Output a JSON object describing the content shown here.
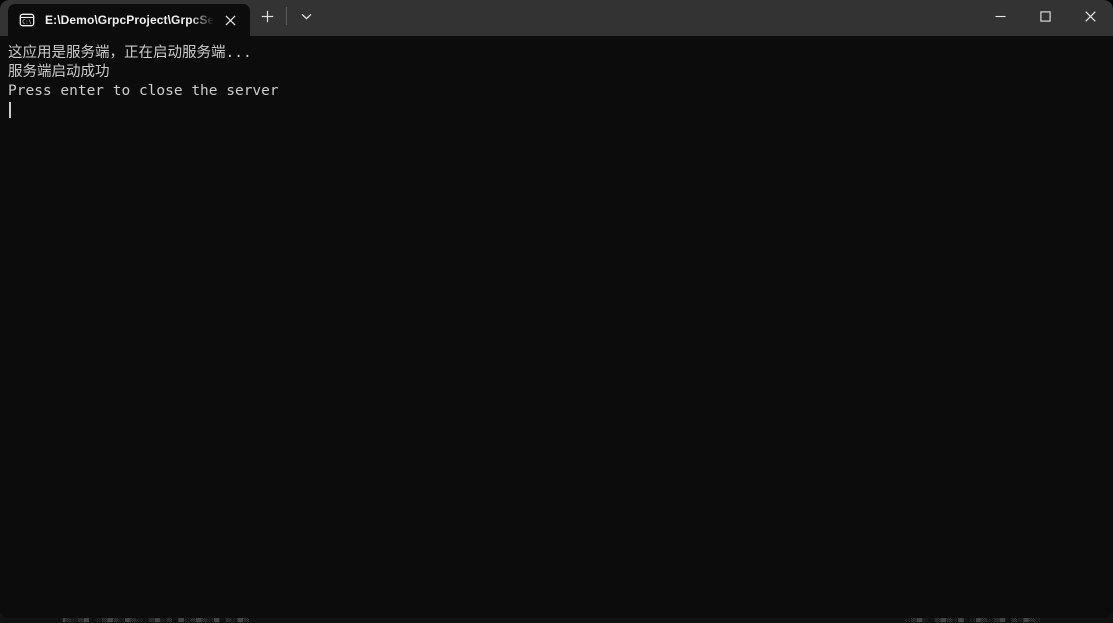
{
  "window": {
    "tab": {
      "icon_name": "console-host-icon",
      "title": "E:\\Demo\\GrpcProject\\GrpcSer",
      "close_icon": "close-icon"
    },
    "tab_actions": {
      "new_tab_icon": "plus-icon",
      "new_tab_label": "+",
      "dropdown_icon": "chevron-down-icon",
      "dropdown_label": "⌄"
    },
    "controls": {
      "minimize_icon": "minimize-icon",
      "maximize_icon": "maximize-icon",
      "close_icon": "close-icon"
    },
    "colors": {
      "titlebar": "#333333",
      "terminal_background": "#0c0c0c",
      "terminal_foreground": "#cccccc",
      "tab_active": "#0c0c0c"
    }
  },
  "terminal": {
    "lines": [
      "这应用是服务端，正在启动服务端...",
      "服务端启动成功",
      "Press enter to close the server"
    ],
    "cursor": "|"
  },
  "background": {
    "ghost_left": "▐▒░▒█ ░▒█▒░█▒░ ▒█░▒ █░▒█▒░█ ▒░█▒",
    "ghost_right": "░▒█░ ▒█▒░█ ░█▒░▒█ ▒░█▒░"
  }
}
